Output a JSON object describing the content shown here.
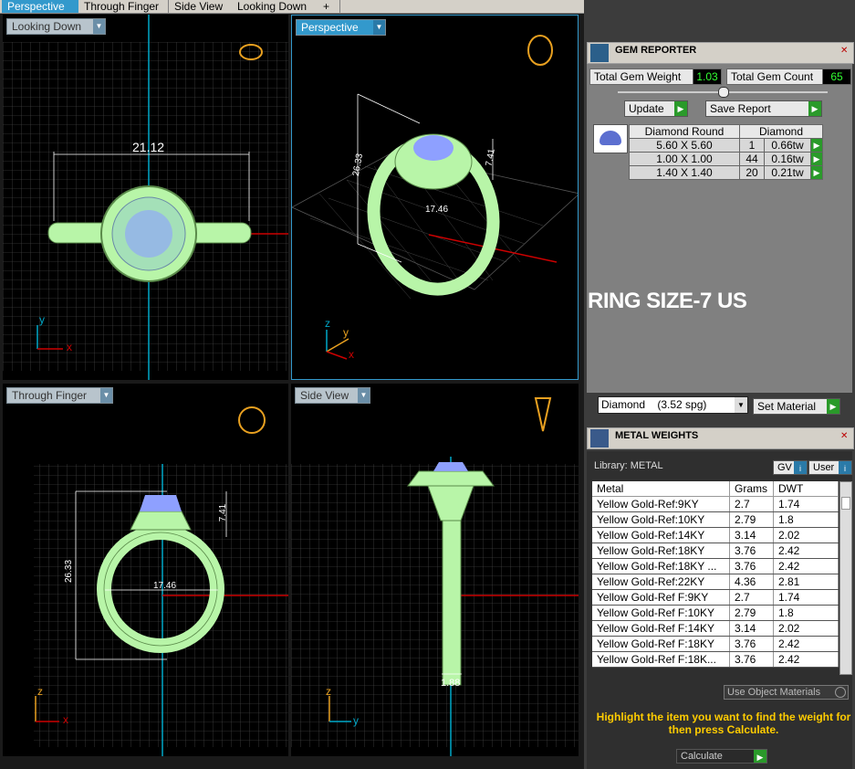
{
  "tabs": [
    "Perspective",
    "Through Finger",
    "Side View",
    "Looking Down",
    "+"
  ],
  "viewports": {
    "top_left": {
      "label": "Looking Down",
      "dim": "21.12"
    },
    "top_right": {
      "label": "Perspective",
      "dims": [
        "26.33",
        "7.41",
        "17.46"
      ]
    },
    "bottom_left": {
      "label": "Through Finger",
      "dims": [
        "26.33",
        "7.41",
        "17.46"
      ]
    },
    "bottom_right": {
      "label": "Side View",
      "dim": "1.88"
    }
  },
  "axes": {
    "x": "x",
    "y": "y",
    "z": "z"
  },
  "gem_reporter": {
    "title": "GEM REPORTER",
    "total_gem_weight_label": "Total Gem Weight",
    "total_gem_weight": "1.03",
    "total_gem_count_label": "Total Gem Count",
    "total_gem_count": "65",
    "update_label": "Update",
    "save_report_label": "Save Report",
    "table_headers": [
      "Diamond Round",
      "Diamond"
    ],
    "rows": [
      {
        "size": "5.60 X 5.60",
        "count": "1",
        "weight": "0.66tw"
      },
      {
        "size": "1.00 X 1.00",
        "count": "44",
        "weight": "0.16tw"
      },
      {
        "size": "1.40 X 1.40",
        "count": "20",
        "weight": "0.21tw"
      }
    ],
    "ring_size": "RING SIZE-7 US",
    "material_select": "Diamond    (3.52 spg)",
    "set_material_label": "Set Material"
  },
  "metal_weights": {
    "title": "METAL WEIGHTS",
    "library_label": "Library: METAL",
    "gv_label": "GV",
    "user_label": "User",
    "headers": [
      "Metal",
      "Grams",
      "DWT"
    ],
    "rows": [
      {
        "metal": "Yellow Gold-Ref:9KY",
        "grams": "2.7",
        "dwt": "1.74"
      },
      {
        "metal": "Yellow Gold-Ref:10KY",
        "grams": "2.79",
        "dwt": "1.8"
      },
      {
        "metal": "Yellow Gold-Ref:14KY",
        "grams": "3.14",
        "dwt": "2.02"
      },
      {
        "metal": "Yellow Gold-Ref:18KY",
        "grams": "3.76",
        "dwt": "2.42"
      },
      {
        "metal": "Yellow Gold-Ref:18KY ...",
        "grams": "3.76",
        "dwt": "2.42"
      },
      {
        "metal": "Yellow Gold-Ref:22KY",
        "grams": "4.36",
        "dwt": "2.81"
      },
      {
        "metal": "Yellow Gold-Ref F:9KY",
        "grams": "2.7",
        "dwt": "1.74"
      },
      {
        "metal": "Yellow Gold-Ref F:10KY",
        "grams": "2.79",
        "dwt": "1.8"
      },
      {
        "metal": "Yellow Gold-Ref F:14KY",
        "grams": "3.14",
        "dwt": "2.02"
      },
      {
        "metal": "Yellow Gold-Ref F:18KY",
        "grams": "3.76",
        "dwt": "2.42"
      },
      {
        "metal": "Yellow Gold-Ref F:18K...",
        "grams": "3.76",
        "dwt": "2.42"
      }
    ],
    "use_object_materials": "Use Object Materials",
    "instruction": "Highlight the item you want to find the weight for then press Calculate.",
    "calculate_label": "Calculate"
  },
  "colors": {
    "ring": "#b8f5a8",
    "stone": "#8ea0ff",
    "accent": "#3399cc",
    "instruction": "#ffcc00"
  }
}
